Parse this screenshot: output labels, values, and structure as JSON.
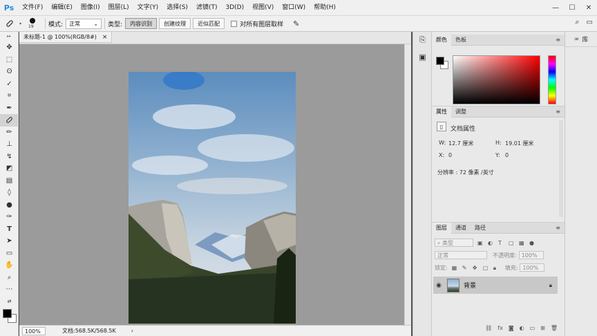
{
  "app": {
    "logo": "Ps"
  },
  "menu": [
    "文件(F)",
    "编辑(E)",
    "图像(I)",
    "图层(L)",
    "文字(Y)",
    "选择(S)",
    "滤镜(T)",
    "3D(D)",
    "视图(V)",
    "窗口(W)",
    "帮助(H)"
  ],
  "window_controls": {
    "minimize": "—",
    "maximize": "☐",
    "close": "✕"
  },
  "options": {
    "brush_size": "19",
    "mode_label": "模式:",
    "mode_value": "正常",
    "type_label": "类型:",
    "type_buttons": [
      "内容识别",
      "创建纹理",
      "近似匹配"
    ],
    "active_type": "内容识别",
    "sample_all_label": "对所有图层取样"
  },
  "document": {
    "tab_title": "未标题-1 @ 100%(RGB/8#)",
    "tab_close": "×",
    "zoom": "100%",
    "doc_info": "文档:568.5K/568.5K",
    "status_arrow": "›"
  },
  "color_panel": {
    "tabs": [
      "颜色",
      "色板"
    ],
    "fg": "#000000",
    "bg": "#ffffff"
  },
  "properties_panel": {
    "tabs": [
      "属性",
      "调整"
    ],
    "title": "文档属性",
    "w_label": "W:",
    "w_value": "12.7 厘米",
    "h_label": "H:",
    "h_value": "19.01 厘米",
    "x_label": "X:",
    "x_value": "0",
    "y_label": "Y:",
    "y_value": "0",
    "resolution": "分辨率 : 72 像素 /英寸"
  },
  "layers_panel": {
    "tabs": [
      "图层",
      "通道",
      "路径"
    ],
    "filter_placeholder": "类型",
    "blend_mode": "正常",
    "opacity_label": "不透明度:",
    "opacity_value": "100%",
    "lock_label": "锁定:",
    "fill_label": "填充:",
    "fill_value": "100%",
    "layers": [
      {
        "name": "背景",
        "visible": true,
        "locked": true
      }
    ]
  },
  "library": {
    "label": "库"
  }
}
